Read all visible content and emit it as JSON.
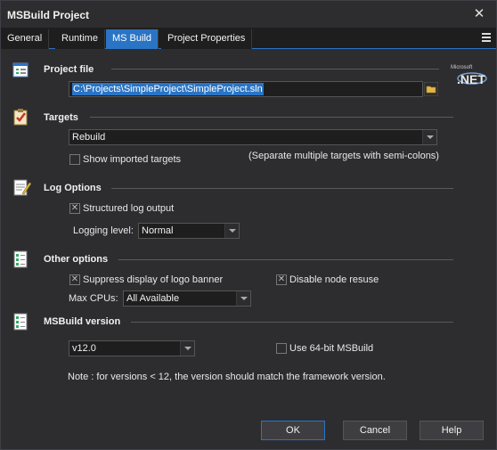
{
  "window": {
    "title": "MSBuild Project"
  },
  "tabs": [
    {
      "label": "General"
    },
    {
      "label": "Runtime"
    },
    {
      "label": "MS Build"
    },
    {
      "label": "Project Properties"
    }
  ],
  "project_file": {
    "title": "Project file",
    "value": "C:\\Projects\\SimpleProject\\SimpleProject.sln"
  },
  "targets": {
    "title": "Targets",
    "value": "Rebuild",
    "show_imported_label": "Show imported targets",
    "hint": "(Separate multiple targets with semi-colons)"
  },
  "log_options": {
    "title": "Log Options",
    "structured_label": "Structured log output",
    "logging_level_label": "Logging level:",
    "logging_level_value": "Normal"
  },
  "other_options": {
    "title": "Other options",
    "suppress_logo_label": "Suppress display of logo banner",
    "disable_node_reuse_label": "Disable node resuse",
    "max_cpus_label": "Max CPUs:",
    "max_cpus_value": "All Available"
  },
  "msbuild_version": {
    "title": "MSBuild version",
    "value": "v12.0",
    "use64_label": "Use 64-bit MSBuild",
    "note": "Note : for versions < 12, the version should match the framework version."
  },
  "logo_text": "Microsoft .NET",
  "buttons": {
    "ok": "OK",
    "cancel": "Cancel",
    "help": "Help"
  },
  "checked_mark": "✕",
  "colors": {
    "accent": "#2a74c5",
    "background": "#2d2d30",
    "field": "#1e1e1e"
  }
}
